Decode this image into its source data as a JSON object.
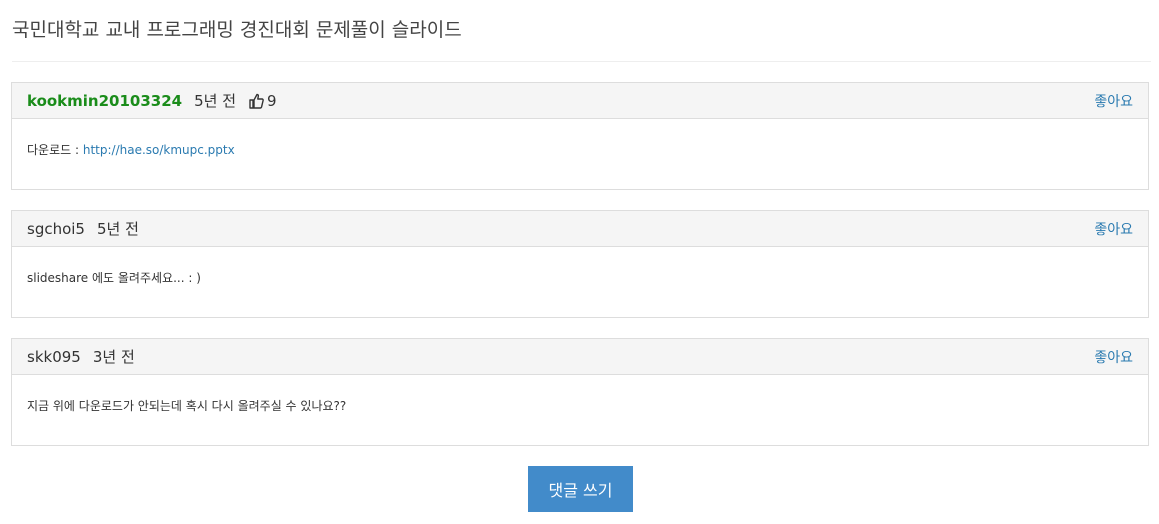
{
  "page": {
    "title": "국민대학교 교내 프로그래밍 경진대회 문제풀이 슬라이드"
  },
  "comments": [
    {
      "author": "kookmin20103324",
      "time": "5년 전",
      "likes": "9",
      "like_label": "좋아요",
      "body_prefix": "다운로드 : ",
      "link_text": "http://hae.so/kmupc.pptx"
    },
    {
      "author": "sgchoi5",
      "time": "5년 전",
      "like_label": "좋아요",
      "body": "slideshare 에도 올려주세요... : )"
    },
    {
      "author": "skk095",
      "time": "3년 전",
      "like_label": "좋아요",
      "body": "지금 위에 다운로드가 안되는데 혹시 다시 올려주실 수 있나요??"
    }
  ],
  "actions": {
    "write_comment": "댓글 쓰기"
  },
  "colors": {
    "accent": "#428bca",
    "link": "#2a7ab0",
    "author_highlight": "#1a8c1a"
  },
  "icons": {
    "like": "thumbs-up-icon"
  }
}
